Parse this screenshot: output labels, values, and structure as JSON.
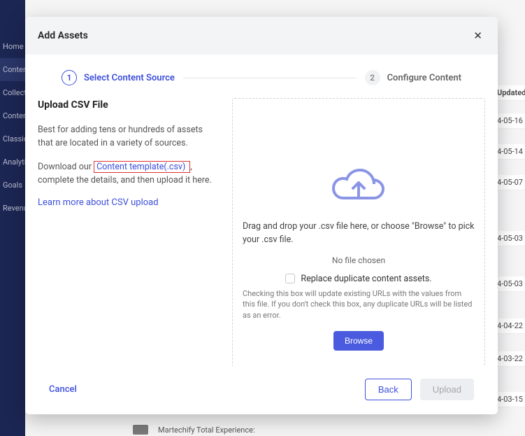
{
  "sidebar": {
    "items": [
      {
        "label": "Home"
      },
      {
        "label": "Content"
      },
      {
        "label": "Collections"
      },
      {
        "label": "Content"
      },
      {
        "label": "Classic Explore"
      },
      {
        "label": "Analytics"
      },
      {
        "label": "Goals"
      },
      {
        "label": "Revenue"
      }
    ]
  },
  "bg_table": {
    "header": "Updated",
    "rows": [
      "4-05-16",
      "4-05-14",
      "4-05-07",
      "4-05-03",
      "4-05-03",
      "4-04-22",
      "4-03-22",
      "4-03-15"
    ]
  },
  "bg_bottom": "Martechify Total Experience:",
  "modal": {
    "title": "Add Assets",
    "steps": [
      {
        "num": "1",
        "label": "Select Content Source"
      },
      {
        "num": "2",
        "label": "Configure Content"
      }
    ],
    "upload": {
      "heading": "Upload CSV File",
      "desc": "Best for adding tens or hundreds of assets that are located in a variety of sources.",
      "download_prefix": "Download our ",
      "template_link": "Content template(.csv) ",
      "download_suffix": ", complete the details, and then upload it here.",
      "learn_more": "Learn more about CSV upload"
    },
    "dropzone": {
      "drag_text": "Drag and drop your .csv file here, or choose \"Browse\" to pick your .csv file.",
      "no_file": "No file chosen",
      "replace_label": "Replace duplicate content assets.",
      "hint": "Checking this box will update existing URLs with the values from this file. If you don't check this box, any duplicate URLs will be listed as an error.",
      "browse": "Browse"
    },
    "footer": {
      "cancel": "Cancel",
      "back": "Back",
      "upload": "Upload"
    }
  }
}
